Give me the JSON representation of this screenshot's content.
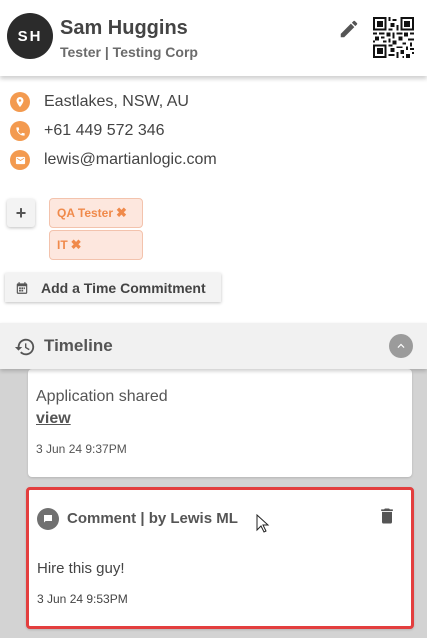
{
  "profile": {
    "initials": "SH",
    "name": "Sam Huggins",
    "role": "Tester | Testing Corp"
  },
  "contact": {
    "location": "Eastlakes, NSW, AU",
    "phone": "+61 449 572 346",
    "email": "lewis@martianlogic.com"
  },
  "tags": [
    {
      "label": "QA Tester"
    },
    {
      "label": "IT"
    }
  ],
  "tag_remove_glyph": "✖",
  "add_button_label": "+",
  "time_commitment": {
    "label": "Add a Time Commitment"
  },
  "timeline": {
    "title": "Timeline",
    "entries": [
      {
        "message": "Application shared",
        "link": "view",
        "timestamp": "3 Jun 24 9:37PM"
      },
      {
        "title": "Comment | by Lewis ML",
        "message": "Hire this guy!",
        "timestamp": "3 Jun 24 9:53PM"
      }
    ]
  },
  "colors": {
    "accent": "#f39a4f",
    "tag_bg": "#fde7de",
    "highlight_border": "#e33e3e",
    "avatar_bg": "#2b2b2b"
  },
  "icons": [
    "pencil-icon",
    "qr-code-icon",
    "location-icon",
    "phone-icon",
    "email-icon",
    "calendar-icon",
    "history-icon",
    "chevron-up-icon",
    "comment-icon",
    "trash-icon",
    "cursor-icon"
  ]
}
